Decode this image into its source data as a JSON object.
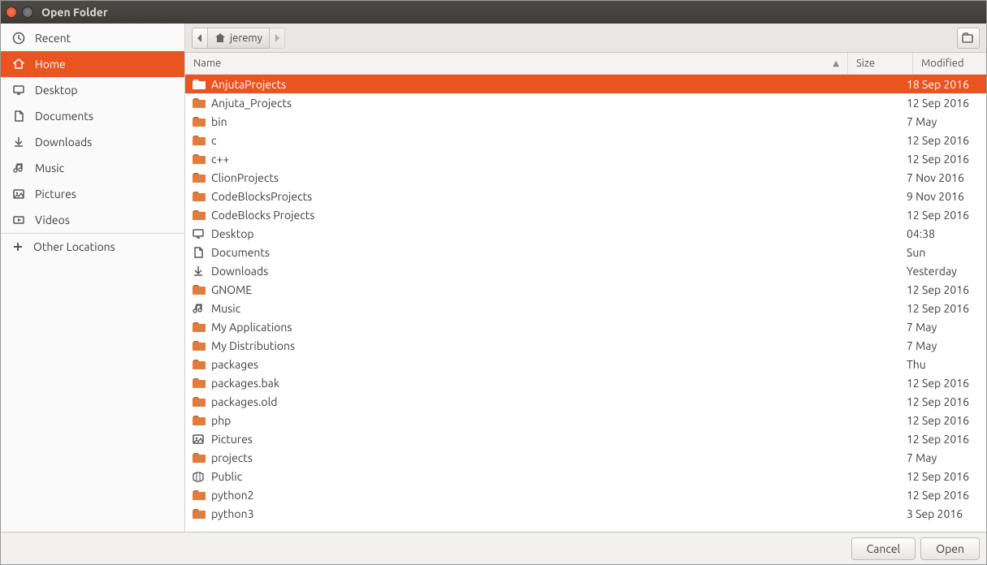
{
  "window": {
    "title": "Open Folder"
  },
  "sidebar": {
    "places": [
      {
        "label": "Recent",
        "icon": "clock",
        "selected": false
      },
      {
        "label": "Home",
        "icon": "home",
        "selected": true
      },
      {
        "label": "Desktop",
        "icon": "desktop",
        "selected": false
      },
      {
        "label": "Documents",
        "icon": "documents",
        "selected": false
      },
      {
        "label": "Downloads",
        "icon": "downloads",
        "selected": false
      },
      {
        "label": "Music",
        "icon": "music",
        "selected": false
      },
      {
        "label": "Pictures",
        "icon": "pictures",
        "selected": false
      },
      {
        "label": "Videos",
        "icon": "videos",
        "selected": false
      }
    ],
    "other": {
      "label": "Other Locations",
      "icon": "plus"
    }
  },
  "breadcrumb": {
    "back_enabled": true,
    "segments": [
      {
        "label": "jeremy",
        "icon": "home",
        "current": true
      }
    ],
    "forward_enabled": false
  },
  "columns": {
    "name": "Name",
    "size": "Size",
    "modified": "Modified",
    "sort": "name",
    "dir": "asc"
  },
  "files": [
    {
      "name": "AnjutaProjects",
      "icon": "folder",
      "size": "",
      "modified": "18 Sep 2016",
      "selected": true
    },
    {
      "name": "Anjuta_Projects",
      "icon": "folder",
      "size": "",
      "modified": "12 Sep 2016",
      "selected": false
    },
    {
      "name": "bin",
      "icon": "folder",
      "size": "",
      "modified": "7 May",
      "selected": false
    },
    {
      "name": "c",
      "icon": "folder",
      "size": "",
      "modified": "12 Sep 2016",
      "selected": false
    },
    {
      "name": "c++",
      "icon": "folder",
      "size": "",
      "modified": "12 Sep 2016",
      "selected": false
    },
    {
      "name": "ClionProjects",
      "icon": "folder",
      "size": "",
      "modified": "7 Nov 2016",
      "selected": false
    },
    {
      "name": "CodeBlocksProjects",
      "icon": "folder",
      "size": "",
      "modified": "9 Nov 2016",
      "selected": false
    },
    {
      "name": "CodeBlocks Projects",
      "icon": "folder",
      "size": "",
      "modified": "12 Sep 2016",
      "selected": false
    },
    {
      "name": "Desktop",
      "icon": "desktop",
      "size": "",
      "modified": "04:38",
      "selected": false
    },
    {
      "name": "Documents",
      "icon": "documents",
      "size": "",
      "modified": "Sun",
      "selected": false
    },
    {
      "name": "Downloads",
      "icon": "downloads",
      "size": "",
      "modified": "Yesterday",
      "selected": false
    },
    {
      "name": "GNOME",
      "icon": "folder",
      "size": "",
      "modified": "12 Sep 2016",
      "selected": false
    },
    {
      "name": "Music",
      "icon": "music",
      "size": "",
      "modified": "12 Sep 2016",
      "selected": false
    },
    {
      "name": "My Applications",
      "icon": "folder",
      "size": "",
      "modified": "7 May",
      "selected": false
    },
    {
      "name": "My Distributions",
      "icon": "folder",
      "size": "",
      "modified": "7 May",
      "selected": false
    },
    {
      "name": "packages",
      "icon": "folder",
      "size": "",
      "modified": "Thu",
      "selected": false
    },
    {
      "name": "packages.bak",
      "icon": "folder",
      "size": "",
      "modified": "12 Sep 2016",
      "selected": false
    },
    {
      "name": "packages.old",
      "icon": "folder",
      "size": "",
      "modified": "12 Sep 2016",
      "selected": false
    },
    {
      "name": "php",
      "icon": "folder",
      "size": "",
      "modified": "12 Sep 2016",
      "selected": false
    },
    {
      "name": "Pictures",
      "icon": "pictures",
      "size": "",
      "modified": "12 Sep 2016",
      "selected": false
    },
    {
      "name": "projects",
      "icon": "folder",
      "size": "",
      "modified": "7 May",
      "selected": false
    },
    {
      "name": "Public",
      "icon": "public",
      "size": "",
      "modified": "12 Sep 2016",
      "selected": false
    },
    {
      "name": "python2",
      "icon": "folder",
      "size": "",
      "modified": "12 Sep 2016",
      "selected": false
    },
    {
      "name": "python3",
      "icon": "folder",
      "size": "",
      "modified": "3 Sep 2016",
      "selected": false
    }
  ],
  "footer": {
    "cancel": "Cancel",
    "open": "Open"
  }
}
